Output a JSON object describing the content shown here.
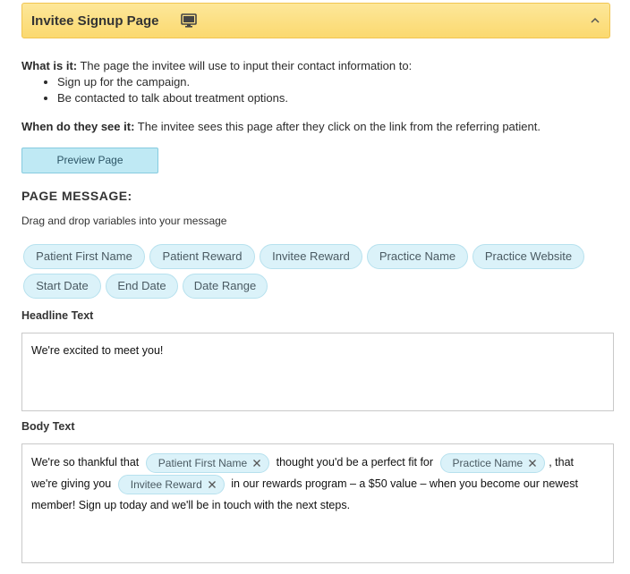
{
  "header": {
    "title": "Invitee Signup Page",
    "icon": "monitor-icon",
    "toggle_icon": "chevron-up-icon"
  },
  "info": {
    "what_label": "What is it:",
    "what_text": " The page the invitee will use to input their contact information to:",
    "bullets": [
      "Sign up for the campaign.",
      "Be contacted to talk about treatment options."
    ],
    "when_label": "When do they see it:",
    "when_text": " The invitee sees this page after they click on the link from the referring patient."
  },
  "preview_button": "Preview Page",
  "page_message": {
    "title": "PAGE MESSAGE:",
    "subtitle": "Drag and drop variables into your message"
  },
  "variables": [
    "Patient First Name",
    "Patient Reward",
    "Invitee Reward",
    "Practice Name",
    "Practice Website",
    "Start Date",
    "End Date",
    "Date Range"
  ],
  "headline": {
    "label": "Headline Text",
    "value": "We're excited to meet you!"
  },
  "body": {
    "label": "Body Text",
    "line1_a": "We're so thankful that",
    "chip1": "Patient First Name",
    "line1_b": "thought you'd be a perfect fit for",
    "chip2": "Practice Name",
    "line1_c": ", that",
    "line2_a": "we're giving you",
    "chip3": "Invitee Reward",
    "line2_b": "in our rewards program – a $50 value – when you become our newest",
    "line3": "member! Sign up today and we'll be in touch with the next steps."
  }
}
